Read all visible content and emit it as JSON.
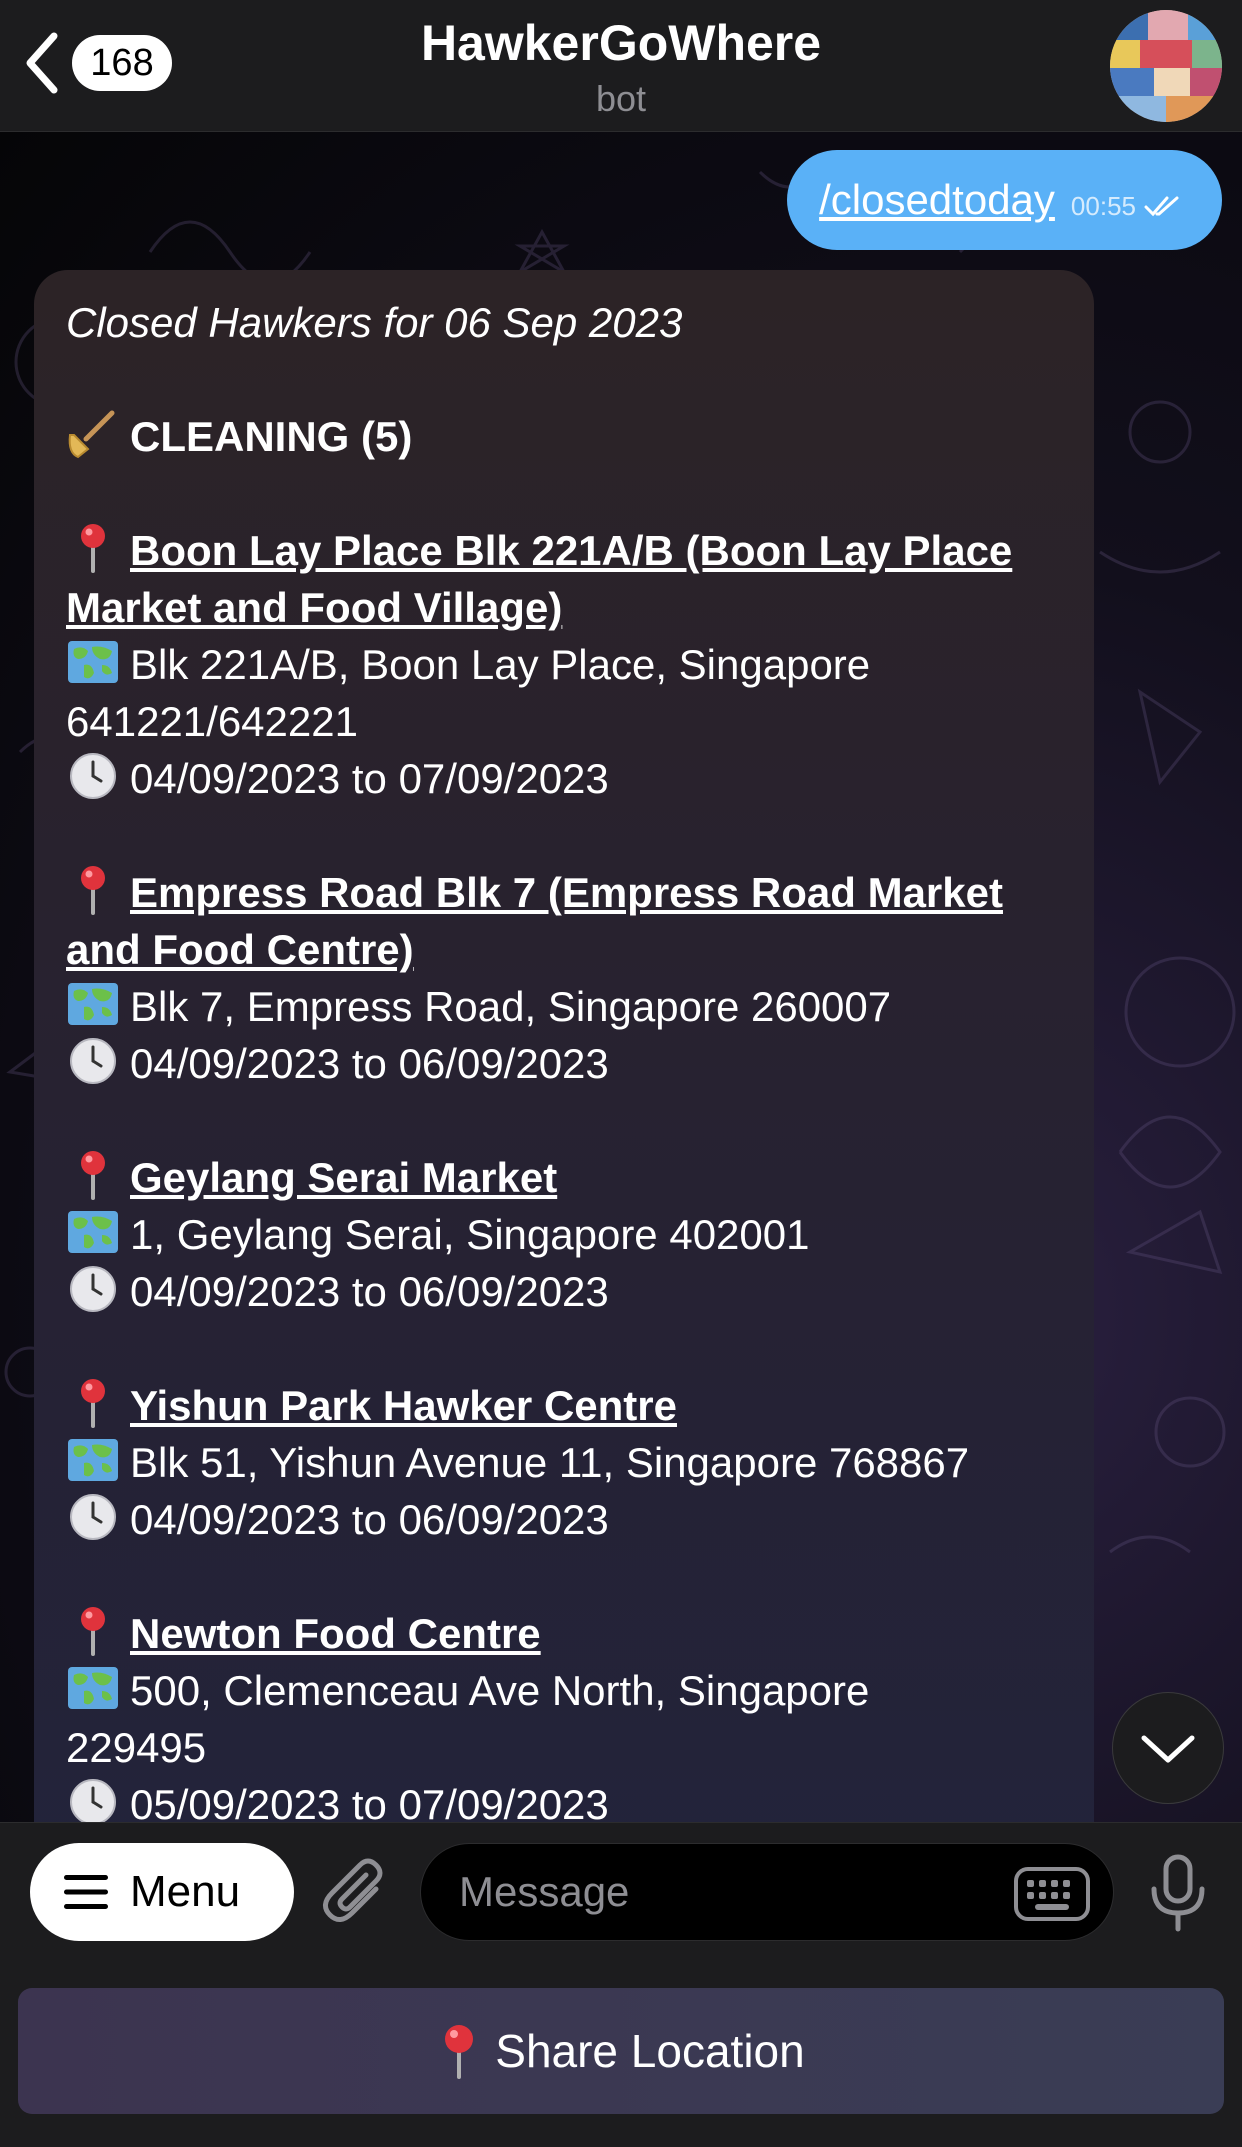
{
  "header": {
    "back_count": "168",
    "title": "HawkerGoWhere",
    "subtitle": "bot"
  },
  "outgoing": {
    "command": "/closedtoday",
    "time": "00:55"
  },
  "message": {
    "title": "Closed Hawkers for 06 Sep 2023",
    "section_heading": "CLEANING (5)",
    "entries": [
      {
        "name_lines": [
          "Boon Lay Place Blk 221A/B (Boon Lay Place",
          "Market and Food Village)"
        ],
        "address_lines": [
          "Blk 221A/B, Boon Lay Place, Singapore",
          "641221/642221"
        ],
        "dates": "04/09/2023 to 07/09/2023"
      },
      {
        "name_lines": [
          "Empress Road Blk 7 (Empress Road Market",
          "and Food Centre)"
        ],
        "address_lines": [
          "Blk 7, Empress Road, Singapore 260007"
        ],
        "dates": "04/09/2023 to 06/09/2023"
      },
      {
        "name_lines": [
          "Geylang Serai Market"
        ],
        "address_lines": [
          "1, Geylang Serai, Singapore 402001"
        ],
        "dates": "04/09/2023 to 06/09/2023"
      },
      {
        "name_lines": [
          "Yishun Park Hawker Centre"
        ],
        "address_lines": [
          "Blk 51, Yishun Avenue 11, Singapore 768867"
        ],
        "dates": "04/09/2023 to 06/09/2023"
      },
      {
        "name_lines": [
          "Newton Food Centre"
        ],
        "address_lines": [
          "500, Clemenceau Ave North, Singapore",
          "229495"
        ],
        "dates": "05/09/2023 to 07/09/2023"
      }
    ]
  },
  "input": {
    "menu_label": "Menu",
    "placeholder": "Message"
  },
  "reply_keyboard": {
    "share_location_label": "Share Location"
  },
  "icons": {
    "back": "chevron-left-icon",
    "section": "broom-icon",
    "pin": "round-pushpin-icon",
    "map": "world-map-icon",
    "clock": "clock-icon",
    "attach": "paperclip-icon",
    "keyboard": "keyboard-icon",
    "mic": "microphone-icon",
    "scroll_down": "chevron-down-icon"
  },
  "colors": {
    "outgoing_bubble": "#5ab1f7",
    "header_bg": "#1c1c1e"
  }
}
